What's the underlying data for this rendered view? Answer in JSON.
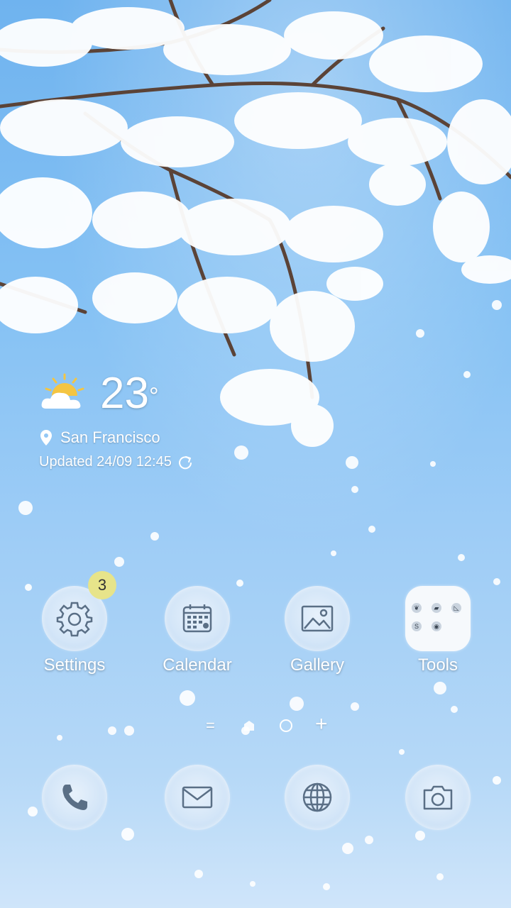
{
  "weather": {
    "temperature": "23",
    "unit": "°",
    "location": "San Francisco",
    "updated": "Updated 24/09 12:45",
    "icon": "partly-sunny-icon"
  },
  "apps": [
    {
      "label": "Settings",
      "icon": "gear-icon",
      "badge": "3"
    },
    {
      "label": "Calendar",
      "icon": "calendar-icon"
    },
    {
      "label": "Gallery",
      "icon": "image-icon"
    },
    {
      "label": "Tools",
      "icon": "folder-icon"
    }
  ],
  "dock": [
    {
      "icon": "phone-icon"
    },
    {
      "icon": "mail-icon"
    },
    {
      "icon": "globe-icon"
    },
    {
      "icon": "camera-icon"
    }
  ],
  "colors": {
    "icon_stroke": "#5a6f86",
    "badge": "#e7e48a",
    "sky": "#86c2f4"
  }
}
